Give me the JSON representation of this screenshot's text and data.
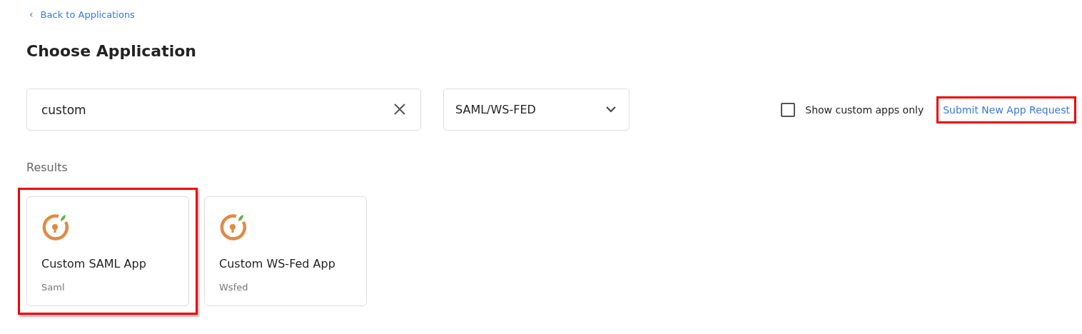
{
  "back_link": {
    "icon": "‹",
    "label": "Back to Applications"
  },
  "title": "Choose Application",
  "search": {
    "value": "custom"
  },
  "protocol_select": {
    "value": "SAML/WS-FED"
  },
  "custom_only": {
    "label": "Show custom apps only",
    "checked": false
  },
  "submit_link": {
    "label": "Submit New App Request",
    "highlighted": true
  },
  "results_label": "Results",
  "apps": [
    {
      "name": "Custom SAML App",
      "type": "Saml",
      "highlighted": true
    },
    {
      "name": "Custom WS-Fed App",
      "type": "Wsfed",
      "highlighted": false
    }
  ]
}
